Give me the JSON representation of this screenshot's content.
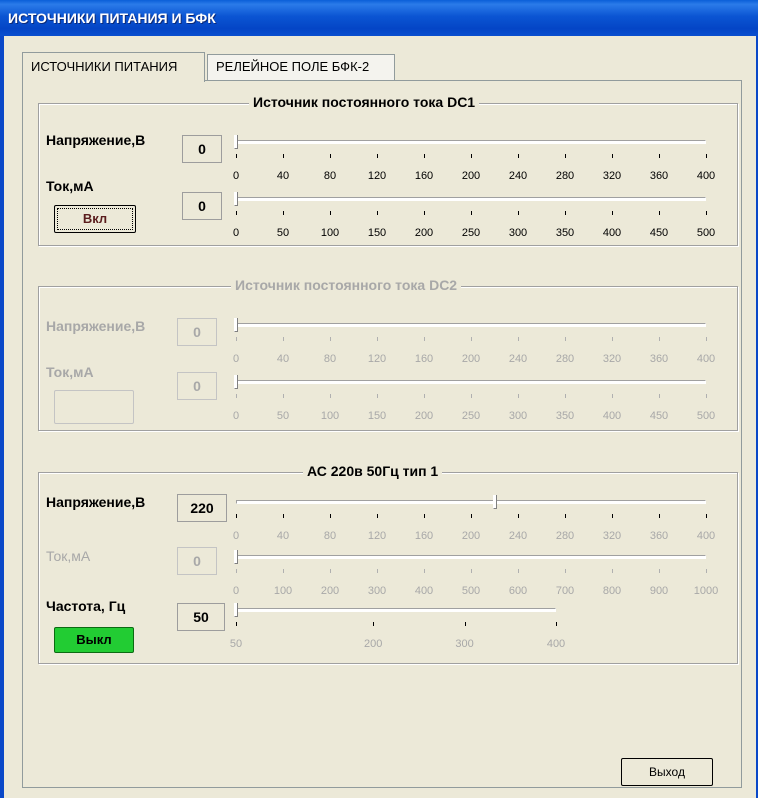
{
  "window": {
    "title": "ИСТОЧНИКИ ПИТАНИЯ И БФК"
  },
  "tabs": [
    {
      "label": "ИСТОЧНИКИ ПИТАНИЯ",
      "active": true
    },
    {
      "label": "РЕЛЕЙНОЕ ПОЛЕ БФК-2",
      "active": false
    }
  ],
  "dc1": {
    "title": "Источник постоянного тока DC1",
    "voltage_label": "Напряжение,В",
    "voltage_value": "0",
    "current_label": "Ток,мА",
    "current_value": "0",
    "button_label": "Вкл",
    "voltage_ticks": [
      "0",
      "40",
      "80",
      "120",
      "160",
      "200",
      "240",
      "280",
      "320",
      "360",
      "400"
    ],
    "current_ticks": [
      "0",
      "50",
      "100",
      "150",
      "200",
      "250",
      "300",
      "350",
      "400",
      "450",
      "500"
    ]
  },
  "dc2": {
    "title": "Источник постоянного тока DC2",
    "voltage_label": "Напряжение,В",
    "voltage_value": "0",
    "current_label": "Ток,мА",
    "current_value": "0",
    "button_label": "",
    "voltage_ticks": [
      "0",
      "40",
      "80",
      "120",
      "160",
      "200",
      "240",
      "280",
      "320",
      "360",
      "400"
    ],
    "current_ticks": [
      "0",
      "50",
      "100",
      "150",
      "200",
      "250",
      "300",
      "350",
      "400",
      "450",
      "500"
    ]
  },
  "ac": {
    "title": "АС 220в 50Гц тип 1",
    "voltage_label": "Напряжение,В",
    "voltage_value": "220",
    "current_label": "Ток,мА",
    "current_value": "0",
    "freq_label": "Частота, Гц",
    "freq_value": "50",
    "button_label": "Выкл",
    "voltage_ticks": [
      "0",
      "40",
      "80",
      "120",
      "160",
      "200",
      "240",
      "280",
      "320",
      "360",
      "400"
    ],
    "current_ticks": [
      "0",
      "100",
      "200",
      "300",
      "400",
      "500",
      "600",
      "700",
      "800",
      "900",
      "1000"
    ],
    "freq_ticks": [
      "50",
      "200",
      "300",
      "400"
    ]
  },
  "footer": {
    "exit_label": "Выход"
  },
  "colors": {
    "titlebar": "#0b55d3",
    "on_button": "#22cc33",
    "window_bg": "#ece9d8"
  }
}
